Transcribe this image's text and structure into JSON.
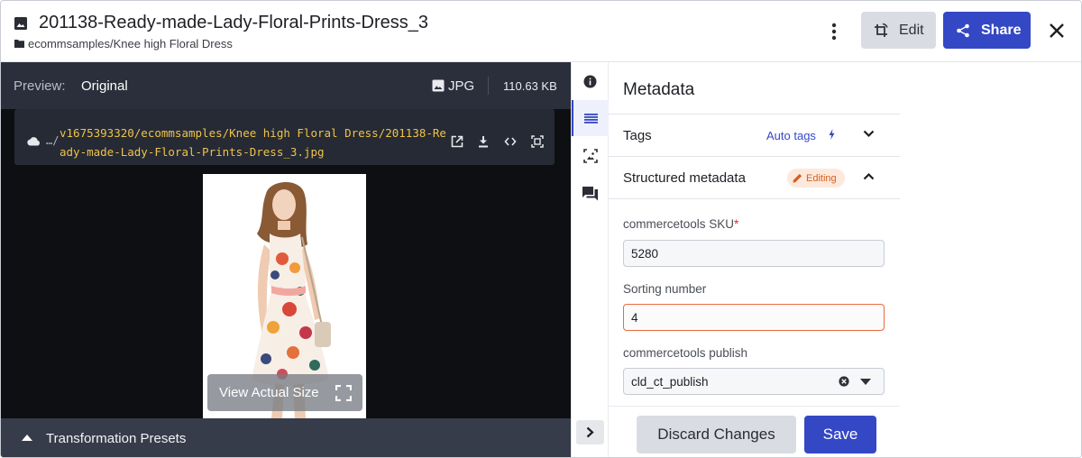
{
  "header": {
    "title": "201138-Ready-made-Lady-Floral-Prints-Dress_3",
    "folder_path": "ecommsamples/Knee high Floral Dress",
    "edit_label": "Edit",
    "share_label": "Share"
  },
  "preview": {
    "label": "Preview:",
    "value": "Original",
    "format": "JPG",
    "file_size": "110.63 KB",
    "url_prefix": "…/",
    "url": "v1675393320/ecommsamples/Knee high Floral Dress/201138-Ready-made-Lady-Floral-Prints-Dress_3.jpg",
    "view_actual_label": "View Actual Size",
    "presets_label": "Transformation Presets"
  },
  "metadata": {
    "title": "Metadata",
    "tags_label": "Tags",
    "auto_tags_label": "Auto tags",
    "structured_label": "Structured metadata",
    "editing_badge": "Editing",
    "fields": [
      {
        "label": "commercetools SKU",
        "required_mark": "*",
        "value": "5280"
      },
      {
        "label": "Sorting number",
        "value": "4"
      },
      {
        "label": "commercetools publish",
        "value": "cld_ct_publish"
      }
    ],
    "discard_label": "Discard Changes",
    "save_label": "Save"
  },
  "colors": {
    "accent": "#3448c5",
    "dark_bg": "#0d0f13",
    "toolbar_bg": "#2a2f3b",
    "url_text": "#f0c24b",
    "editing_badge": "#d4601e",
    "error_border": "#ea6a3c"
  },
  "icons": {
    "header_image": "image-icon",
    "folder": "folder-icon",
    "more": "more-vertical-icon",
    "edit": "crop-rotate-icon",
    "share": "share-icon",
    "close": "close-icon",
    "cloud": "cloud-icon",
    "open_new": "open-in-new-icon",
    "download": "download-icon",
    "embed": "code-icon",
    "crop": "crop-frame-icon",
    "fullscreen": "fullscreen-icon",
    "info": "info-icon",
    "metadata": "list-icon",
    "image_analysis": "image-frame-icon",
    "comments": "comment-icon",
    "expand": "chevron-right-icon"
  }
}
